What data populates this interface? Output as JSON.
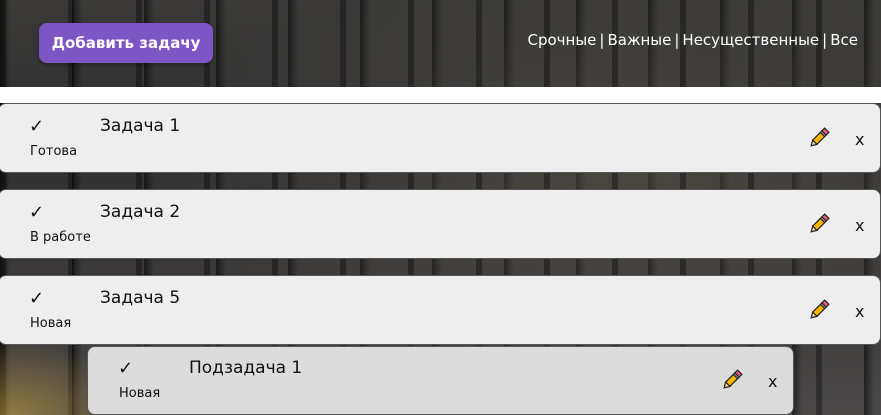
{
  "header": {
    "add_button": "Добавить задачу",
    "filters": [
      "Срочные",
      "Важные",
      "Несущественные",
      "Все"
    ]
  },
  "tasks": [
    {
      "check": "✓",
      "title": "Задача 1",
      "status": "Готова",
      "delete": "x"
    },
    {
      "check": "✓",
      "title": "Задача 2",
      "status": "В работе",
      "delete": "x"
    },
    {
      "check": "✓",
      "title": "Задача 5",
      "status": "Новая",
      "delete": "x"
    }
  ],
  "subtasks": [
    {
      "check": "✓",
      "title": "Подзадача 1",
      "status": "Новая",
      "delete": "x"
    }
  ],
  "colors": {
    "accent": "#7e55c4",
    "card": "#eeeeee",
    "subcard": "#dcdcdc"
  },
  "icons": {
    "edit": "pencil-icon",
    "complete": "checkmark-icon",
    "delete": "close-icon"
  }
}
